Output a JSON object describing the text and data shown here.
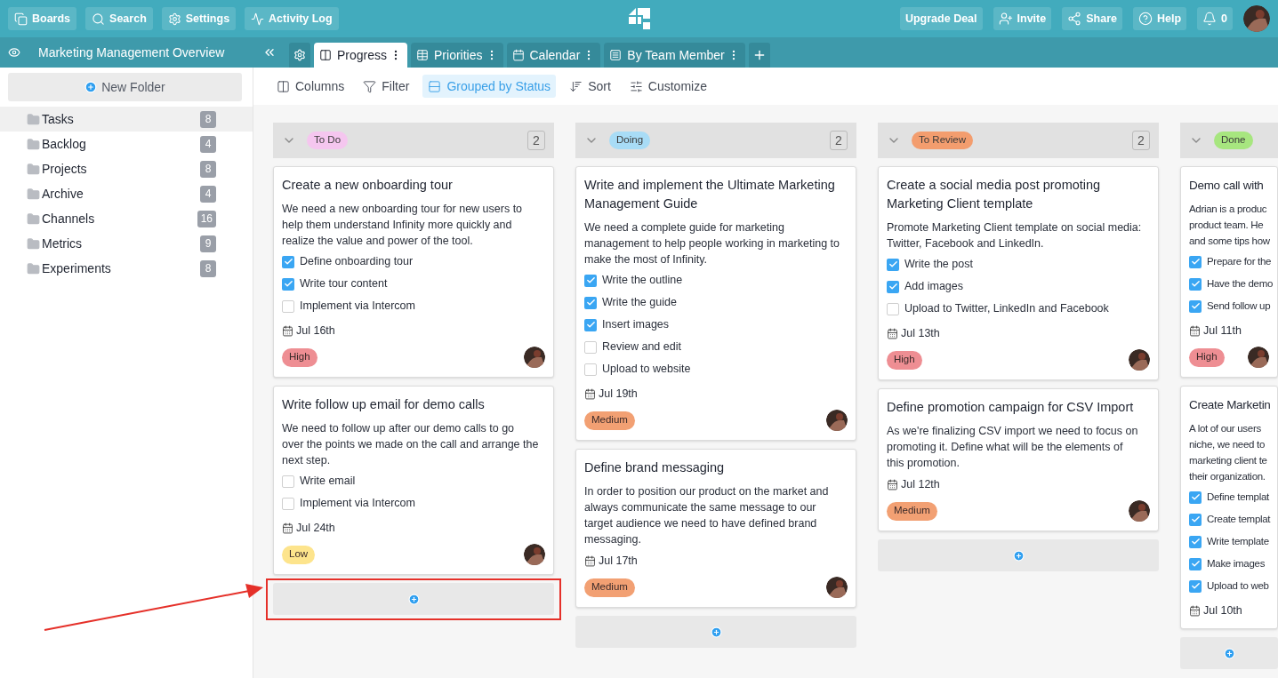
{
  "topbar": {
    "left_buttons": [
      {
        "label": "Boards"
      },
      {
        "label": "Search"
      },
      {
        "label": "Settings"
      },
      {
        "label": "Activity Log"
      }
    ],
    "right_buttons": [
      {
        "label": "Upgrade Deal"
      },
      {
        "label": "Invite"
      },
      {
        "label": "Share"
      },
      {
        "label": "Help"
      },
      {
        "label": "0"
      }
    ]
  },
  "board_title": "Marketing Management Overview",
  "tabs": [
    {
      "label": "Progress",
      "selected": true
    },
    {
      "label": "Priorities",
      "selected": false
    },
    {
      "label": "Calendar",
      "selected": false
    },
    {
      "label": "By Team Member",
      "selected": false
    }
  ],
  "sidebar": {
    "new_folder": "New Folder",
    "folders": [
      {
        "name": "Tasks",
        "count": "8",
        "selected": true
      },
      {
        "name": "Backlog",
        "count": "4",
        "selected": false
      },
      {
        "name": "Projects",
        "count": "8",
        "selected": false
      },
      {
        "name": "Archive",
        "count": "4",
        "selected": false
      },
      {
        "name": "Channels",
        "count": "16",
        "selected": false
      },
      {
        "name": "Metrics",
        "count": "9",
        "selected": false
      },
      {
        "name": "Experiments",
        "count": "8",
        "selected": false
      }
    ]
  },
  "toolbar": [
    {
      "label": "Columns",
      "selected": false
    },
    {
      "label": "Filter",
      "selected": false
    },
    {
      "label": "Grouped by Status",
      "selected": true
    },
    {
      "label": "Sort",
      "selected": false
    },
    {
      "label": "Customize",
      "selected": false
    }
  ],
  "columns": [
    {
      "status": "To Do",
      "color": "#f5c6ef",
      "count": "2",
      "cards": [
        {
          "title": [
            "Create a new onboarding tour"
          ],
          "description": [
            "We need a new onboarding tour for new users to",
            "help them understand Infinity more quickly and",
            "realize the value and power of the tool."
          ],
          "checklist": [
            {
              "label": "Define onboarding tour",
              "checked": true
            },
            {
              "label": "Write tour content",
              "checked": true
            },
            {
              "label": "Implement via Intercom",
              "checked": false
            }
          ],
          "date": "Jul 16th",
          "priority": {
            "label": "High",
            "color": "#ee8e93"
          }
        },
        {
          "title": [
            "Write follow up email for demo calls"
          ],
          "description": [
            "We need to follow up after our demo calls to go",
            "over the points we made on the call and arrange the",
            "next step."
          ],
          "checklist": [
            {
              "label": "Write email",
              "checked": false
            },
            {
              "label": "Implement via Intercom",
              "checked": false
            }
          ],
          "date": "Jul 24th",
          "priority": {
            "label": "Low",
            "color": "#fde48c"
          }
        }
      ]
    },
    {
      "status": "Doing",
      "color": "#a8dcf6",
      "count": "2",
      "cards": [
        {
          "title": [
            "Write and implement the Ultimate Marketing",
            "Management Guide"
          ],
          "description": [
            "We need a complete guide for marketing",
            "management to help people working in marketing to",
            "make the most of Infinity."
          ],
          "checklist": [
            {
              "label": "Write the outline",
              "checked": true
            },
            {
              "label": "Write the guide",
              "checked": true
            },
            {
              "label": "Insert images",
              "checked": true
            },
            {
              "label": "Review and edit",
              "checked": false
            },
            {
              "label": "Upload to website",
              "checked": false
            }
          ],
          "date": "Jul 19th",
          "priority": {
            "label": "Medium",
            "color": "#f2a073"
          }
        },
        {
          "title": [
            "Define brand messaging"
          ],
          "description": [
            "In order to position our product on the market and",
            "always communicate the same message to our",
            "target audience we need to have defined brand",
            "messaging."
          ],
          "date": "Jul 17th",
          "priority": {
            "label": "Medium",
            "color": "#f2a073"
          }
        }
      ]
    },
    {
      "status": "To Review",
      "color": "#f39d6e",
      "count": "2",
      "cards": [
        {
          "title": [
            "Create a social media post promoting",
            "Marketing Client template"
          ],
          "description": [
            "Promote Marketing Client template on social media:",
            "Twitter, Facebook and LinkedIn."
          ],
          "checklist": [
            {
              "label": "Write the post",
              "checked": true
            },
            {
              "label": "Add images",
              "checked": true
            },
            {
              "label": "Upload to Twitter, LinkedIn and Facebook",
              "checked": false
            }
          ],
          "date": "Jul 13th",
          "priority": {
            "label": "High",
            "color": "#ee8e93"
          }
        },
        {
          "title": [
            "Define promotion campaign for CSV Import"
          ],
          "description": [
            "As we're finalizing CSV import we need to focus on",
            "promoting it. Define what will be the elements of",
            "this promotion."
          ],
          "date": "Jul 12th",
          "priority": {
            "label": "Medium",
            "color": "#f2a073"
          }
        }
      ]
    },
    {
      "status": "Done",
      "color": "#a7e67f",
      "cards": [
        {
          "title": [
            "Demo call with"
          ],
          "description": [
            "Adrian is a produc",
            "product team. He",
            "and some tips how"
          ],
          "checklist": [
            {
              "label": "Prepare for the",
              "checked": true
            },
            {
              "label": "Have the demo",
              "checked": true
            },
            {
              "label": "Send follow up",
              "checked": true
            }
          ],
          "date": "Jul 11th",
          "priority": {
            "label": "High",
            "color": "#ee8e93"
          }
        },
        {
          "title": [
            "Create Marketin"
          ],
          "description": [
            "A lot of our users",
            "niche, we need to",
            "marketing client te",
            "their organization."
          ],
          "checklist": [
            {
              "label": "Define templat",
              "checked": true
            },
            {
              "label": "Create templat",
              "checked": true
            },
            {
              "label": "Write template",
              "checked": true
            },
            {
              "label": "Make images",
              "checked": true
            },
            {
              "label": "Upload to web",
              "checked": true
            }
          ],
          "date": "Jul 10th"
        }
      ]
    }
  ]
}
